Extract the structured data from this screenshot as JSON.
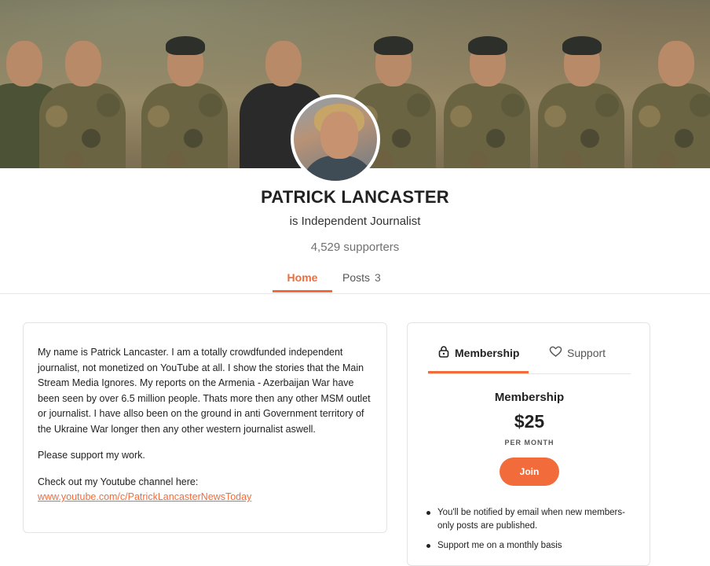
{
  "profile": {
    "name": "PATRICK LANCASTER",
    "tagline": "is Independent Journalist",
    "supporters": "4,529 supporters"
  },
  "tabs": {
    "home": "Home",
    "posts": "Posts",
    "posts_count": "3"
  },
  "about": {
    "paragraph1": "My name is Patrick Lancaster. I am a totally crowdfunded independent journalist, not monetized on YouTube at all. I show the stories that the Main Stream Media Ignores. My reports on the Armenia - Azerbaijan War have been seen by over 6.5 million people. Thats more then any other MSM outlet or journalist. I have allso been on the ground in anti Government territory of the Ukraine War longer then any other western journalist aswell.",
    "paragraph2": "Please support my work.",
    "paragraph3_prefix": "Check out my Youtube channel here: ",
    "youtube_link": "www.youtube.com/c/PatrickLancasterNewsToday"
  },
  "membership": {
    "tab_membership": "Membership",
    "tab_support": "Support",
    "title": "Membership",
    "price": "$25",
    "period": "PER MONTH",
    "join_label": "Join",
    "benefits": [
      "You'll be notified by email when new members-only posts are published.",
      "Support me on a monthly basis"
    ]
  },
  "colors": {
    "accent": "#f26b3a",
    "text": "#222222",
    "muted": "#717171",
    "border": "#e4e4e4"
  },
  "icons": {
    "membership_tab": "lock-icon",
    "support_tab": "heart-icon"
  }
}
